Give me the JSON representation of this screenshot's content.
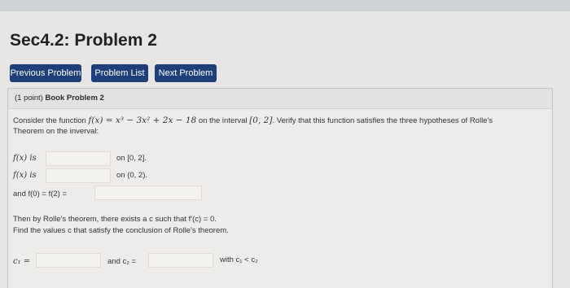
{
  "page": {
    "title": "Sec4.2: Problem 2"
  },
  "nav": {
    "previous": "Previous Problem",
    "list": "Problem List",
    "next": "Next Problem"
  },
  "problem": {
    "points": "(1 point)",
    "name": "Book Problem 2",
    "intro_pre": "Consider the function",
    "function": "f(x) = x³ − 3x² + 2x − 18",
    "intro_mid": "on the interval",
    "interval": "[0, 2]",
    "intro_post": ". Verify that this function satisfies the three hypotheses of Rolle's",
    "intro_line2": "Theorem on the inverval:",
    "h1_label": "f(x) is",
    "h1_suffix": "on [0, 2].",
    "h2_label": "f(x) is",
    "h2_suffix": "on (0, 2).",
    "h3_label": "and f(0) = f(2) =",
    "conclusion_1": "Then by Rolle's theorem, there exists a c such that f′(c) = 0.",
    "conclusion_2": "Find the values c that satisfy the conclusion of Rolle's theorem.",
    "c1_label": "c₁ =",
    "c2_label": "and c₂ =",
    "order_note": "with c₁ < c₂"
  },
  "inputs": {
    "h1": "",
    "h2": "",
    "h3": "",
    "c1": "",
    "c2": ""
  }
}
